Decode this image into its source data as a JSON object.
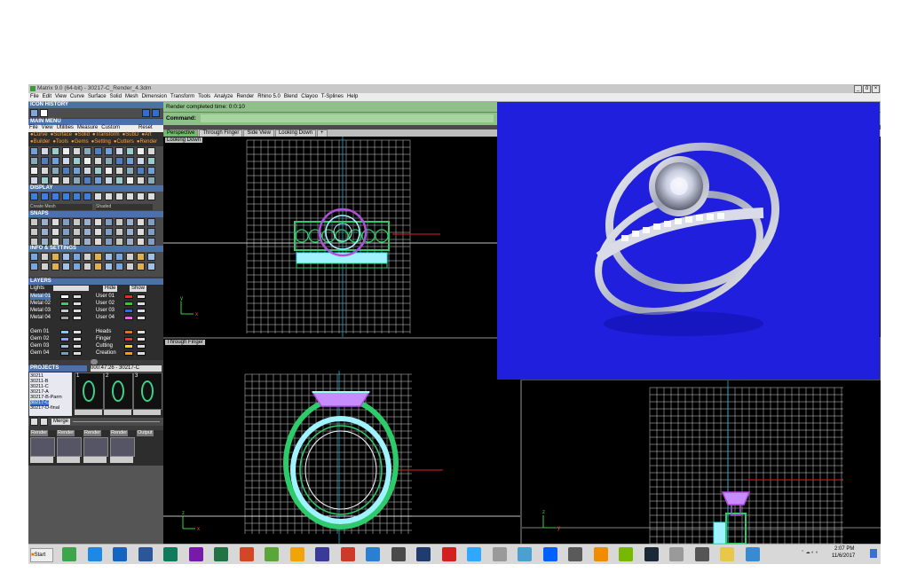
{
  "window": {
    "title": "Matrix 9.0 (64-bit) - 30217-C_Render_4.3dm",
    "controls": [
      "_",
      "ô",
      "×"
    ]
  },
  "menubar": [
    "File",
    "Edit",
    "View",
    "Curve",
    "Surface",
    "Solid",
    "Mesh",
    "Dimension",
    "Transform",
    "Tools",
    "Analyze",
    "Render",
    "Rhino 5.0",
    "Blend",
    "Clayoo",
    "T-Splines",
    "Help"
  ],
  "left_panel": {
    "icon_history": "ICON HISTORY",
    "main_menu": "MAIN MENU",
    "main_menu_items": [
      "File",
      "View",
      "Utilities",
      "Measure",
      "Custom"
    ],
    "reset": "Reset",
    "categories_row1": [
      "Curve",
      "Surface",
      "Solid",
      "Transform",
      "SubD",
      "Art"
    ],
    "categories_row2": [
      "Builder",
      "Tools",
      "Gems",
      "Setting",
      "Cutters",
      "Render"
    ],
    "display": "DISPLAY",
    "display_left": "Create Mesh",
    "display_right": "Shaded",
    "snaps": "SNAPS",
    "info_settings": "INFO & SETTINGS",
    "layers": "LAYERS",
    "lights": "Lights",
    "hide_label": "Hide",
    "show_label": "Show",
    "layers_left": [
      "Metal 01",
      "Metal 02",
      "Metal 03",
      "Metal 04",
      "",
      "Gem 01",
      "Gem 02",
      "Gem 03",
      "Gem 04"
    ],
    "layers_right": [
      "User 01",
      "User 02",
      "User 03",
      "User 04",
      "",
      "Heads",
      "Finger",
      "Cutting",
      "Creation"
    ],
    "projects": "PROJECTS",
    "project_timer": "000:47:26 - 30217-C",
    "project_list": [
      "30211",
      "30211-B",
      "30211-C",
      "30217-A",
      "30217-B-Parm",
      "30217-C",
      "30217-D-final"
    ],
    "thumb_numbers": [
      "1",
      "2",
      "3"
    ],
    "merge": "Merge",
    "render_tabs": [
      "Render",
      "Render",
      "Render",
      "Render",
      "Output"
    ]
  },
  "status": {
    "render_line": "Render completed time: 0:0:10",
    "command_label": "Command:"
  },
  "viewport_tabs": [
    "Perspective",
    "Through Finger",
    "Side View",
    "Looking Down",
    "+"
  ],
  "viewport_labels": {
    "top": "Looking Down",
    "bottom_left": "Through Finger"
  },
  "axes": {
    "top_y": "y",
    "top_x": "x",
    "bl_z": "z",
    "bl_x": "x",
    "br_z": "z",
    "br_y": "y"
  },
  "taskbar": {
    "start": "Start",
    "time": "2:07 PM",
    "date": "11/6/2017",
    "icons": [
      "chrome-icon",
      "onedrive-icon",
      "outlook-icon",
      "word-icon",
      "publisher-icon",
      "onenote-icon",
      "excel-icon",
      "powerpoint-icon",
      "matrix-icon",
      "security-icon",
      "substance-icon",
      "substance-designer-icon",
      "app-icon",
      "app2-icon",
      "photoshop-icon",
      "media-icon",
      "lightroom-icon",
      "tools-icon",
      "app3-icon",
      "dropbox-icon",
      "calculator-icon",
      "vlc-icon",
      "nvidia-icon",
      "steam-icon",
      "rhino-icon",
      "app4-icon",
      "folder-icon",
      "display-icon"
    ]
  },
  "colors": {
    "render_bg": "#1f1fdd",
    "wire_green": "#2ecb6a",
    "wire_purple": "#b14ee0",
    "wire_cyan": "#9ff3ff",
    "grid": "#cfcfcf"
  }
}
